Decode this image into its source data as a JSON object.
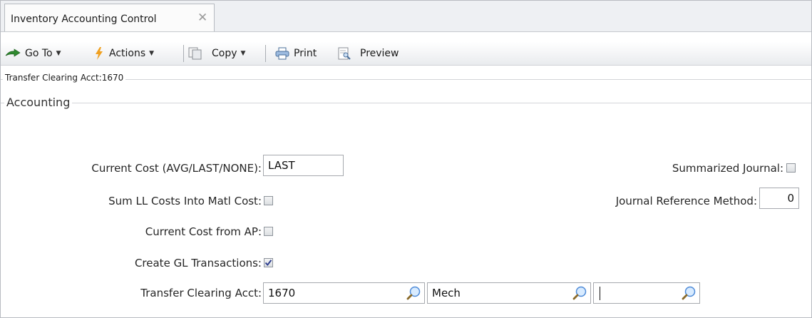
{
  "tab": {
    "title": "Inventory Accounting Control",
    "close_glyph": "✕"
  },
  "toolbar": {
    "goto_label": "Go To",
    "actions_label": "Actions",
    "copy_label": "Copy",
    "print_label": "Print",
    "preview_label": "Preview",
    "icons": [
      "goto-arrow-icon",
      "actions-lightning-icon",
      "copy-icon",
      "print-icon",
      "preview-icon"
    ]
  },
  "summary": {
    "label": "Transfer Clearing Acct:1670"
  },
  "group": {
    "title": "Accounting"
  },
  "form": {
    "current_cost_label": "Current Cost (AVG/LAST/NONE):",
    "current_cost_value": "LAST",
    "sum_ll_label": "Sum LL Costs Into Matl Cost:",
    "sum_ll_checked": false,
    "cost_from_ap_label": "Current Cost from AP:",
    "cost_from_ap_checked": false,
    "create_gl_label": "Create GL Transactions:",
    "create_gl_checked": true,
    "transfer_acct_label": "Transfer Clearing Acct:",
    "transfer_acct_value": "1670",
    "transfer_desc_value": "Mech",
    "transfer_third_value": "",
    "summarized_journal_label": "Summarized Journal:",
    "summarized_journal_checked": false,
    "journal_ref_label": "Journal Reference Method:",
    "journal_ref_value": "0"
  },
  "colors": {
    "check_mark": "#2f3f8f",
    "lookup_lens": "#6aa6e8",
    "goto_arrow": "#2f8a2f",
    "actions_bolt": "#f0a020"
  }
}
